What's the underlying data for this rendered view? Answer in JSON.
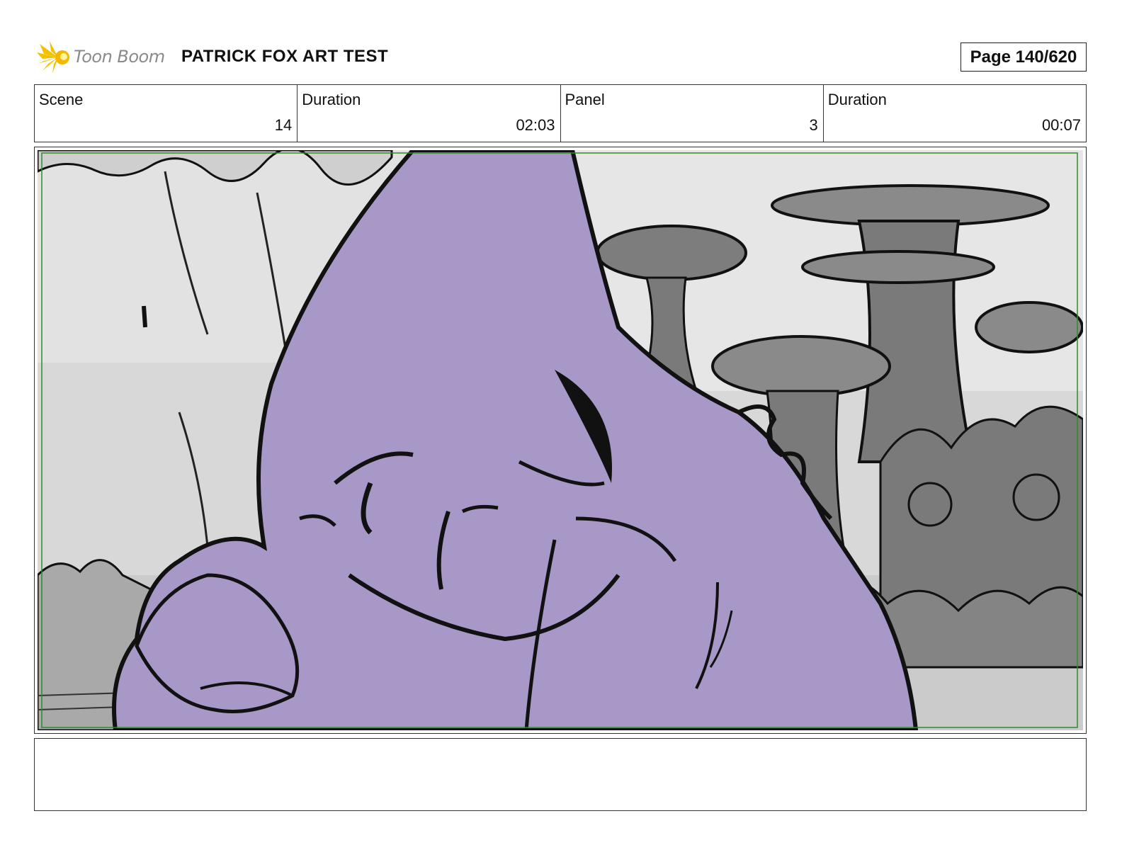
{
  "header": {
    "logo_text": "Toon Boom",
    "project_title": "PATRICK FOX ART TEST",
    "page_label": "Page 140/620"
  },
  "info": [
    {
      "label": "Scene",
      "value": "14"
    },
    {
      "label": "Duration",
      "value": "02:03"
    },
    {
      "label": "Panel",
      "value": "3"
    },
    {
      "label": "Duration",
      "value": "00:07"
    }
  ],
  "panel": {
    "image_icon": "storyboard-sketch",
    "colors": {
      "character": "#a898c8",
      "ink": "#111111",
      "background": "#cfcfcf",
      "mushroom": "#7a7a7a",
      "safe_frame": "#2e8b2e"
    }
  },
  "notes": {
    "text": ""
  }
}
